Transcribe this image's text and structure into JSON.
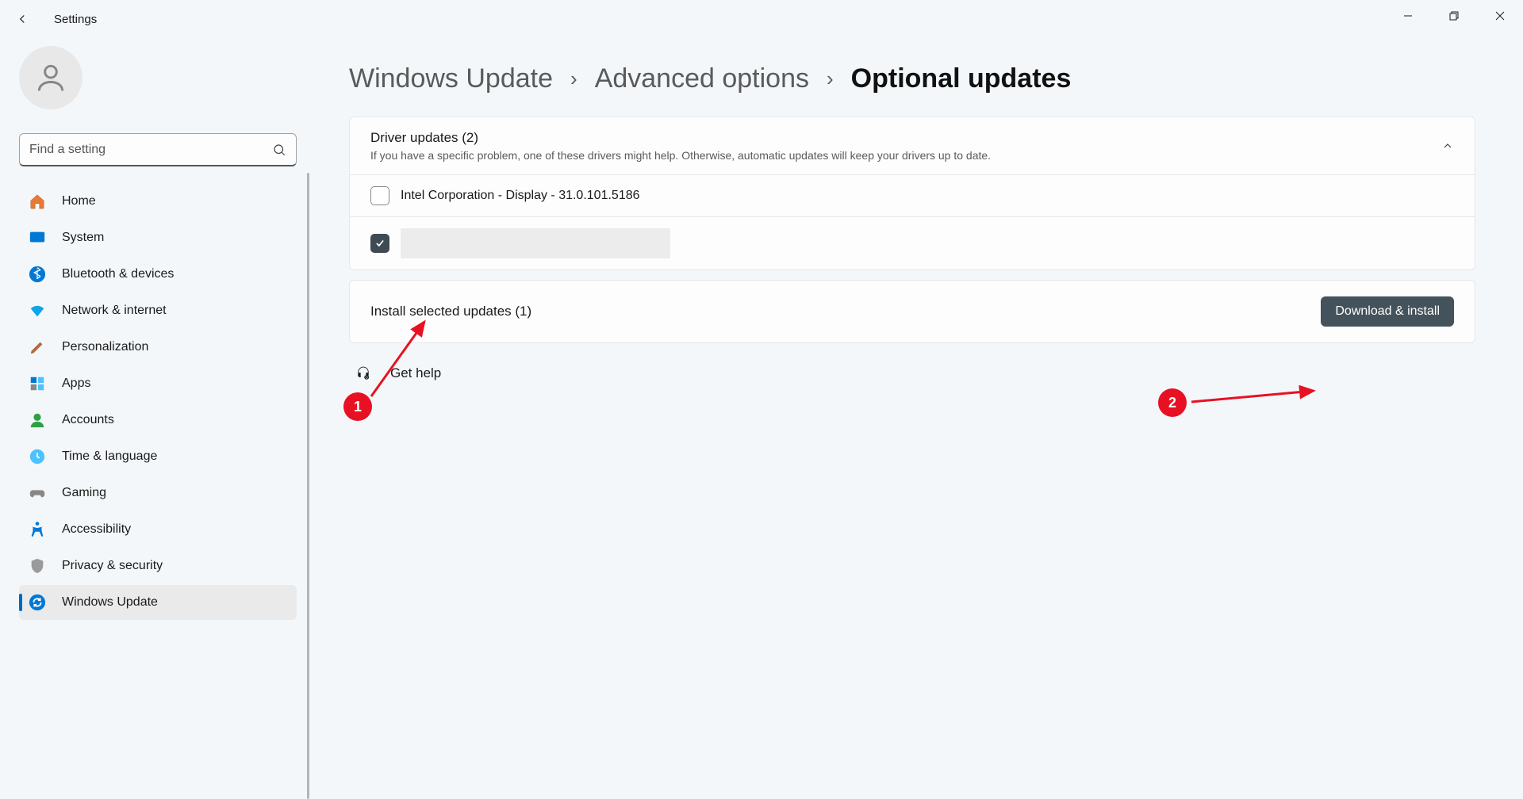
{
  "app": {
    "title": "Settings"
  },
  "search": {
    "placeholder": "Find a setting"
  },
  "sidebar": {
    "items": [
      {
        "label": "Home"
      },
      {
        "label": "System"
      },
      {
        "label": "Bluetooth & devices"
      },
      {
        "label": "Network & internet"
      },
      {
        "label": "Personalization"
      },
      {
        "label": "Apps"
      },
      {
        "label": "Accounts"
      },
      {
        "label": "Time & language"
      },
      {
        "label": "Gaming"
      },
      {
        "label": "Accessibility"
      },
      {
        "label": "Privacy & security"
      },
      {
        "label": "Windows Update"
      }
    ]
  },
  "breadcrumb": {
    "a": "Windows Update",
    "b": "Advanced options",
    "c": "Optional updates"
  },
  "section": {
    "title": "Driver updates (2)",
    "desc": "If you have a specific problem, one of these drivers might help. Otherwise, automatic updates will keep your drivers up to date."
  },
  "updates": {
    "u1": "Intel Corporation - Display - 31.0.101.5186"
  },
  "install": {
    "label": "Install selected updates (1)",
    "button": "Download & install"
  },
  "help": {
    "label": "Get help"
  },
  "callouts": {
    "c1": "1",
    "c2": "2"
  }
}
